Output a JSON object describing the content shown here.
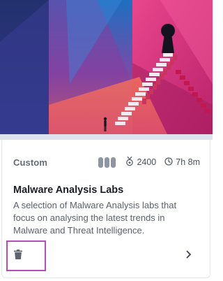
{
  "card": {
    "category": "Custom",
    "difficulty_level": 3,
    "points": "2400",
    "duration": "7h 8m",
    "title": "Malware Analysis Labs",
    "description": "A selection of Malware Analysis labs that focus on analysing the latest trends in Malware and Threat Intelligence.",
    "icons": {
      "points": "medal-icon",
      "duration": "clock-icon",
      "delete": "trash-icon",
      "open": "chevron-right-icon"
    }
  },
  "colors": {
    "highlight_border": "#b24fb8",
    "hero_pink": "#d63a87",
    "hero_blue": "#2c3f8f",
    "hero_orange": "#f06a4a"
  }
}
